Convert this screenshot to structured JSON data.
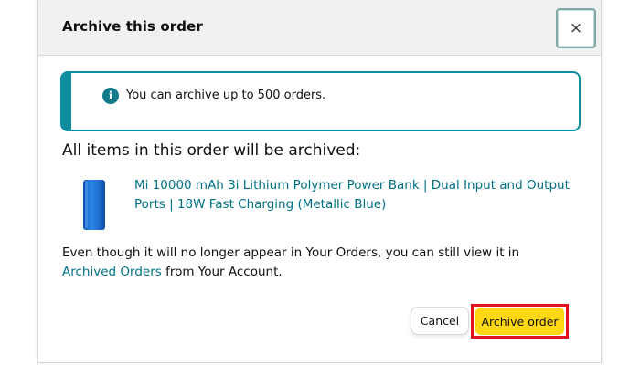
{
  "dialog": {
    "title": "Archive this order",
    "close_symbol": "×"
  },
  "alert": {
    "icon": "info-icon",
    "icon_glyph": "i",
    "text": "You can archive up to 500 orders.",
    "accent_color": "#0f8ea0"
  },
  "section_heading": "All items in this order will be archived:",
  "product": {
    "image_icon": "power-bank-image",
    "image_color": "#1f6fd1",
    "name": "Mi 10000 mAh 3i Lithium Polymer Power Bank | Dual Input and Output Ports | 18W Fast Charging (Metallic Blue)"
  },
  "info": {
    "text_before": "Even though it will no longer appear in Your Orders, you can still view it in ",
    "link": "Archived Orders",
    "text_after": " from Your Account."
  },
  "buttons": {
    "cancel": "Cancel",
    "archive": "Archive order",
    "archive_color": "#ffd814",
    "highlight_color": "#e3101d"
  }
}
